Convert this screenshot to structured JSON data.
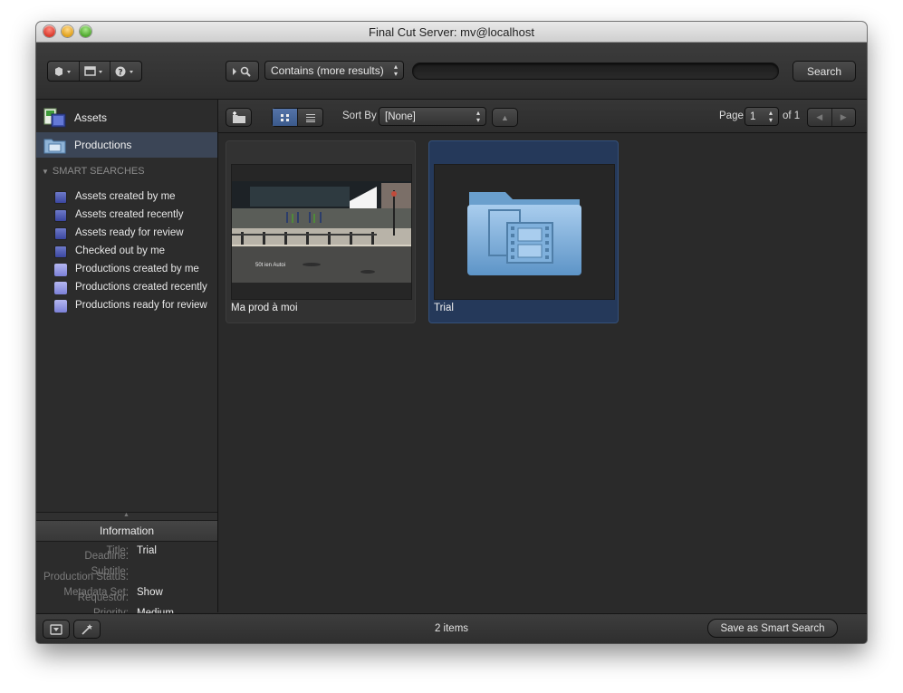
{
  "window": {
    "title": "Final Cut Server: mv@localhost"
  },
  "toolbar": {
    "search_mode": "Contains (more results)",
    "search_value": "",
    "search_button": "Search"
  },
  "sidebar": {
    "sources": [
      {
        "label": "Assets",
        "icon": "assets-icon",
        "selected": false
      },
      {
        "label": "Productions",
        "icon": "productions-icon",
        "selected": true
      }
    ],
    "smart_searches_header": "SMART SEARCHES",
    "smart_searches": [
      {
        "label": "Assets created by me",
        "icon": "asset-search-icon"
      },
      {
        "label": "Assets created recently",
        "icon": "asset-search-icon"
      },
      {
        "label": "Assets ready for review",
        "icon": "asset-search-icon"
      },
      {
        "label": "Checked out by me",
        "icon": "asset-search-icon"
      },
      {
        "label": "Productions created by me",
        "icon": "production-search-icon"
      },
      {
        "label": "Productions created recently",
        "icon": "production-search-icon"
      },
      {
        "label": "Productions ready for review",
        "icon": "production-search-icon"
      }
    ]
  },
  "info": {
    "header": "Information",
    "rows": [
      {
        "key": "Title:",
        "value": "Trial"
      },
      {
        "key": "Subtitle:",
        "value": ""
      },
      {
        "key": "Metadata Set:",
        "value": "Show"
      },
      {
        "key": "Priority:",
        "value": "Medium"
      },
      {
        "key": "Deadline:",
        "value": ""
      },
      {
        "key": "Production Status:",
        "value": ""
      },
      {
        "key": "Requestor:",
        "value": ""
      }
    ]
  },
  "content_bar": {
    "sort_label": "Sort By",
    "sort_value": "[None]",
    "page_label": "Page",
    "page_value": "1",
    "page_of": "of 1"
  },
  "items": [
    {
      "name": "Ma prod à moi",
      "kind": "video-thumbnail",
      "thumb_caption": "50t ien Autoi",
      "selected": false
    },
    {
      "name": "Trial",
      "kind": "production-folder",
      "selected": true
    }
  ],
  "footer": {
    "count": "2 items",
    "save_smart_search": "Save as Smart Search"
  },
  "colors": {
    "selection": "#3b4556",
    "tile_selected": "#25395a"
  }
}
